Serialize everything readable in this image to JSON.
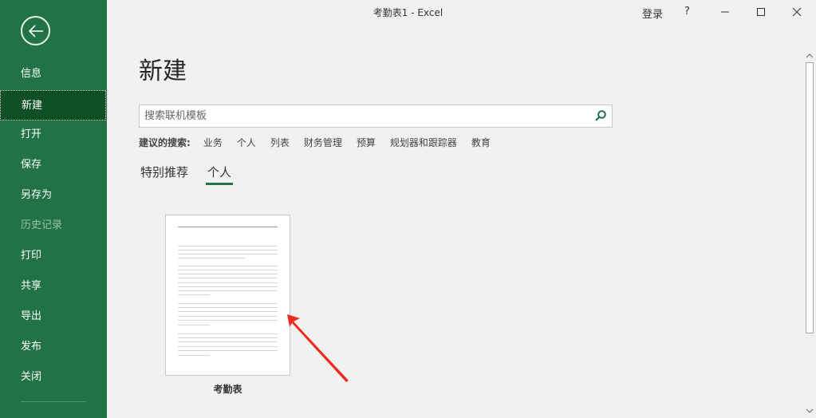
{
  "window": {
    "title": "考勤表1  -  Excel",
    "signin": "登录",
    "help": "?"
  },
  "sidebar": {
    "items": [
      {
        "label": "信息"
      },
      {
        "label": "新建",
        "selected": true
      },
      {
        "label": "打开"
      },
      {
        "label": "保存"
      },
      {
        "label": "另存为"
      },
      {
        "label": "历史记录",
        "disabled": true
      },
      {
        "label": "打印"
      },
      {
        "label": "共享"
      },
      {
        "label": "导出"
      },
      {
        "label": "发布"
      },
      {
        "label": "关闭"
      }
    ]
  },
  "main": {
    "heading": "新建",
    "search_placeholder": "搜索联机模板",
    "suggest_label": "建议的搜索:",
    "suggestions": [
      "业务",
      "个人",
      "列表",
      "财务管理",
      "预算",
      "规划器和跟踪器",
      "教育"
    ],
    "tabs": [
      {
        "label": "特别推荐"
      },
      {
        "label": "个人",
        "active": true
      }
    ],
    "templates": [
      {
        "name": "考勤表"
      }
    ]
  },
  "colors": {
    "accent": "#217346",
    "selected": "#0e4f25",
    "arrow": "#ee2a1e"
  }
}
